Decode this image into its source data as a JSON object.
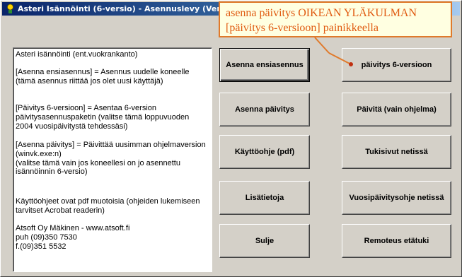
{
  "window": {
    "title": "Asteri Isännöinti (6-versio) - Asennuslevy (Versio:"
  },
  "info": {
    "paragraphs": [
      "Asteri isännöinti (ent.vuokrankanto)",
      "[Asenna ensiasennus] = Asennus uudelle koneelle (tämä asennus riittää jos olet uusi käyttäjä)",
      "[Päivitys 6-versioon] = Asentaa 6-version päivitysasennuspaketin (valitse tämä loppuvuoden 2004 vuosipäivitystä tehdessäsi)",
      "[Asenna päivitys] = Päivittää uusimman ohjelmaversion (winvk.exe:n)\n(valitse tämä vain jos koneellesi on jo asennettu isännöinnin 6-versio)",
      "Käyttöohjeet ovat pdf muotoisia (ohjeiden lukemiseen tarvitset Acrobat readerin)",
      "Atsoft Oy Mäkinen - www.atsoft.fi\npuh (09)350 7530\nf.(09)351 5532"
    ]
  },
  "buttons": {
    "asenna_ensiasennus": "Asenna ensiasennus",
    "paivitys_6": "päivitys 6-versioon",
    "asenna_paivitys": "Asenna päivitys",
    "paivita_vain": "Päivitä (vain ohjelma)",
    "kayttoohje": "Käyttöohje (pdf)",
    "tukisivut": "Tukisivut netissä",
    "lisatietoja": "Lisätietoja",
    "vuosipaivitysohje": "Vuosipäivitysohje netissä",
    "sulje": "Sulje",
    "remoteus": "Remoteus etätuki"
  },
  "callout": {
    "text": "asenna päivitys OIKEAN YLÄKULMAN [päivitys 6-versioon] painikkeella",
    "color": "#e05a10",
    "border_color": "#e07a2b"
  }
}
